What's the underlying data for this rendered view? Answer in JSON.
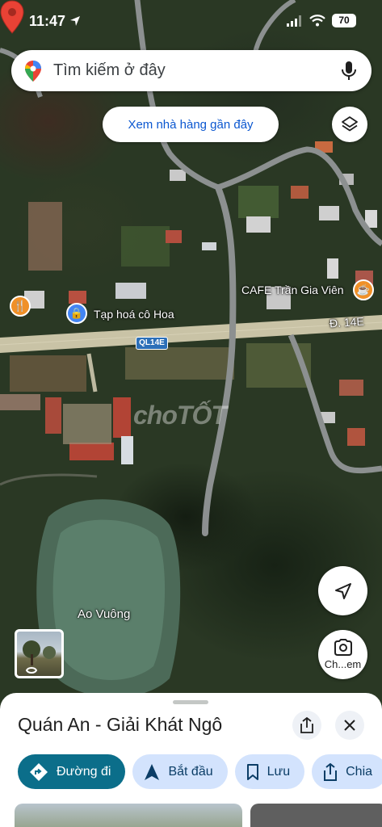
{
  "status_bar": {
    "time": "11:47",
    "battery": "70"
  },
  "search": {
    "placeholder": "Tìm kiếm ở đây"
  },
  "chip": {
    "label": "Xem nhà hàng gần đây"
  },
  "map": {
    "watermark": "choTỐT",
    "labels": {
      "shop": "Tạp hoá cô Hoa",
      "cafe": "CAFE Trần Gia Viên",
      "road_east": "Đ. 14E",
      "road_badge": "QL14E",
      "pond": "Ao Vuông"
    },
    "pin_color": "#e94235"
  },
  "controls": {
    "lens_label": "Ch...em"
  },
  "place": {
    "title": "Quán An - Giải Khát Ngô",
    "actions": [
      {
        "label": "Đường đi",
        "icon": "directions-icon"
      },
      {
        "label": "Bắt đầu",
        "icon": "navigation-arrow-icon"
      },
      {
        "label": "Lưu",
        "icon": "bookmark-icon"
      },
      {
        "label": "Chia",
        "icon": "share-icon"
      }
    ]
  },
  "colors": {
    "accent": "#0b6e8a",
    "chip_text": "#0b57d0",
    "action_bg": "#d3e3fd"
  }
}
